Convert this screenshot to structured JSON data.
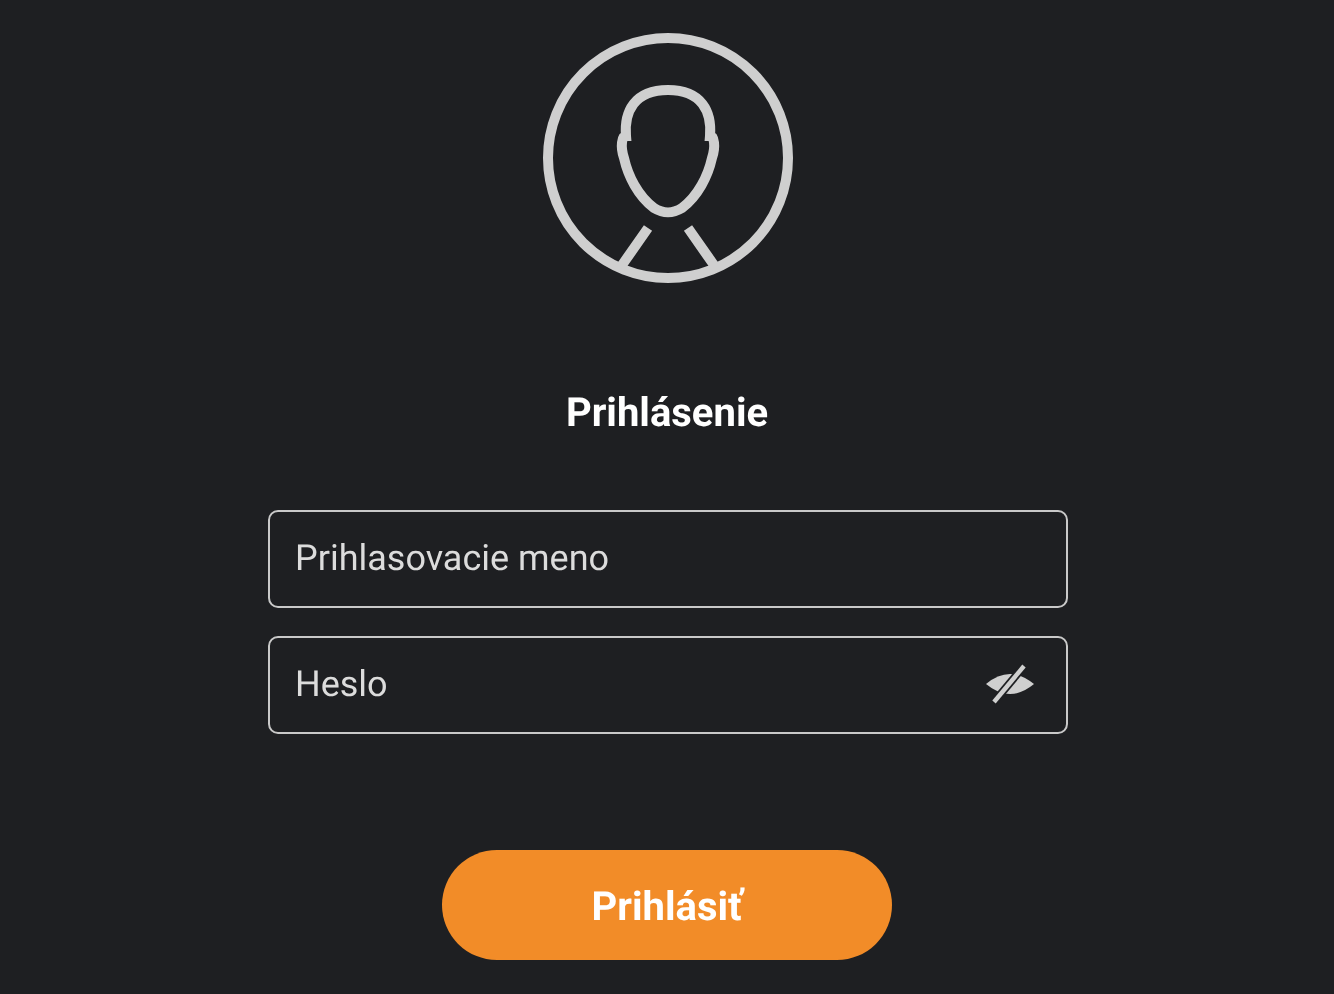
{
  "title": "Prihlásenie",
  "fields": [
    {
      "placeholder": "Prihlasovacie meno",
      "kind": "text"
    },
    {
      "placeholder": "Heslo",
      "kind": "password"
    }
  ],
  "submit": "Prihlásiť"
}
